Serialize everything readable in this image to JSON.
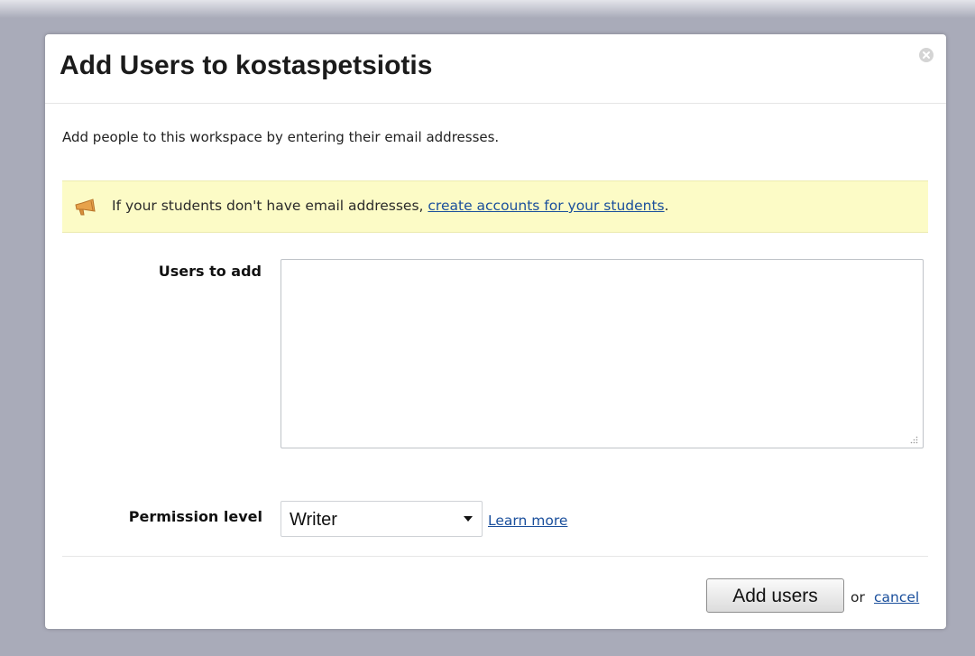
{
  "dialog": {
    "title": "Add Users to kostaspetsiotis",
    "intro": "Add people to this workspace by entering their email addresses."
  },
  "notice": {
    "icon": "megaphone-icon",
    "text_before": "If your students don't have email addresses, ",
    "link_text": "create accounts for your students",
    "text_after": "."
  },
  "form": {
    "users_label": "Users to add",
    "users_value": "",
    "permission_label": "Permission level",
    "permission_selected": "Writer",
    "learn_more": "Learn more"
  },
  "footer": {
    "add_button": "Add users",
    "or_text": "or",
    "cancel_link": "cancel"
  },
  "colors": {
    "backdrop": "#a9abb9",
    "notice_bg": "#fcfbc6",
    "link": "#1a4f9c"
  }
}
